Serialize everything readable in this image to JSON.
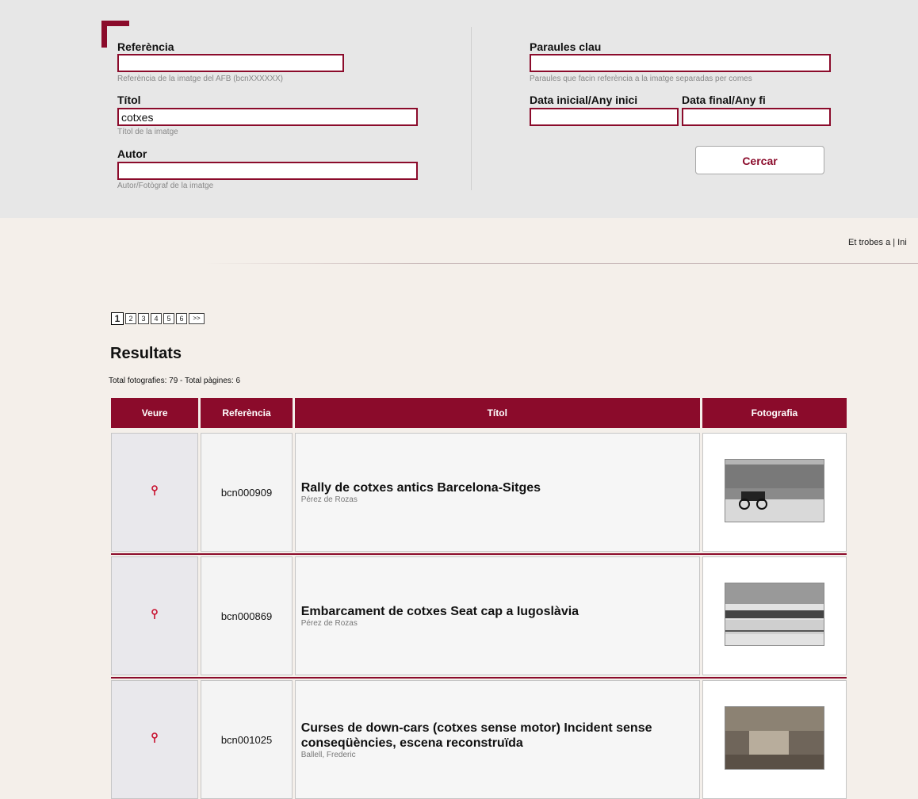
{
  "search": {
    "reference_label": "Referència",
    "reference_value": "",
    "reference_help": "Referència de la imatge del AFB (bcnXXXXXX)",
    "title_label": "Títol",
    "title_value": "cotxes",
    "title_help": "Títol de la imatge",
    "author_label": "Autor",
    "author_value": "",
    "author_help": "Autor/Fotògraf de la imatge",
    "keywords_label": "Paraules clau",
    "keywords_value": "",
    "keywords_help": "Paraules que facin referència a la imatge separadas per comes",
    "start_date_label": "Data inicial/Any inici",
    "start_date_value": "",
    "end_date_label": "Data final/Any fi",
    "end_date_value": "",
    "search_button": "Cercar"
  },
  "top_links": "Et trobes a | Ini",
  "pager": {
    "pages": [
      "1",
      "2",
      "3",
      "4",
      "5",
      "6"
    ],
    "current": "1",
    "next": ">>"
  },
  "results": {
    "heading": "Resultats",
    "summary": "Total fotografies: 79 - Total pàgines: 6",
    "columns": [
      "Veure",
      "Referència",
      "Títol",
      "Fotografia"
    ],
    "rows": [
      {
        "reference": "bcn000909",
        "title": "Rally de cotxes antics Barcelona-Sitges",
        "author": "Pérez de Rozas"
      },
      {
        "reference": "bcn000869",
        "title": "Embarcament de cotxes Seat cap a Iugoslàvia",
        "author": "Pérez de Rozas"
      },
      {
        "reference": "bcn001025",
        "title": "Curses de down-cars (cotxes sense motor) Incident sense conseqüències, escena reconstruïda",
        "author": "Ballell, Frederic"
      }
    ]
  },
  "colors": {
    "accent": "#8b0b2b",
    "panel": "#e7e7e7",
    "page": "#f4efea"
  }
}
